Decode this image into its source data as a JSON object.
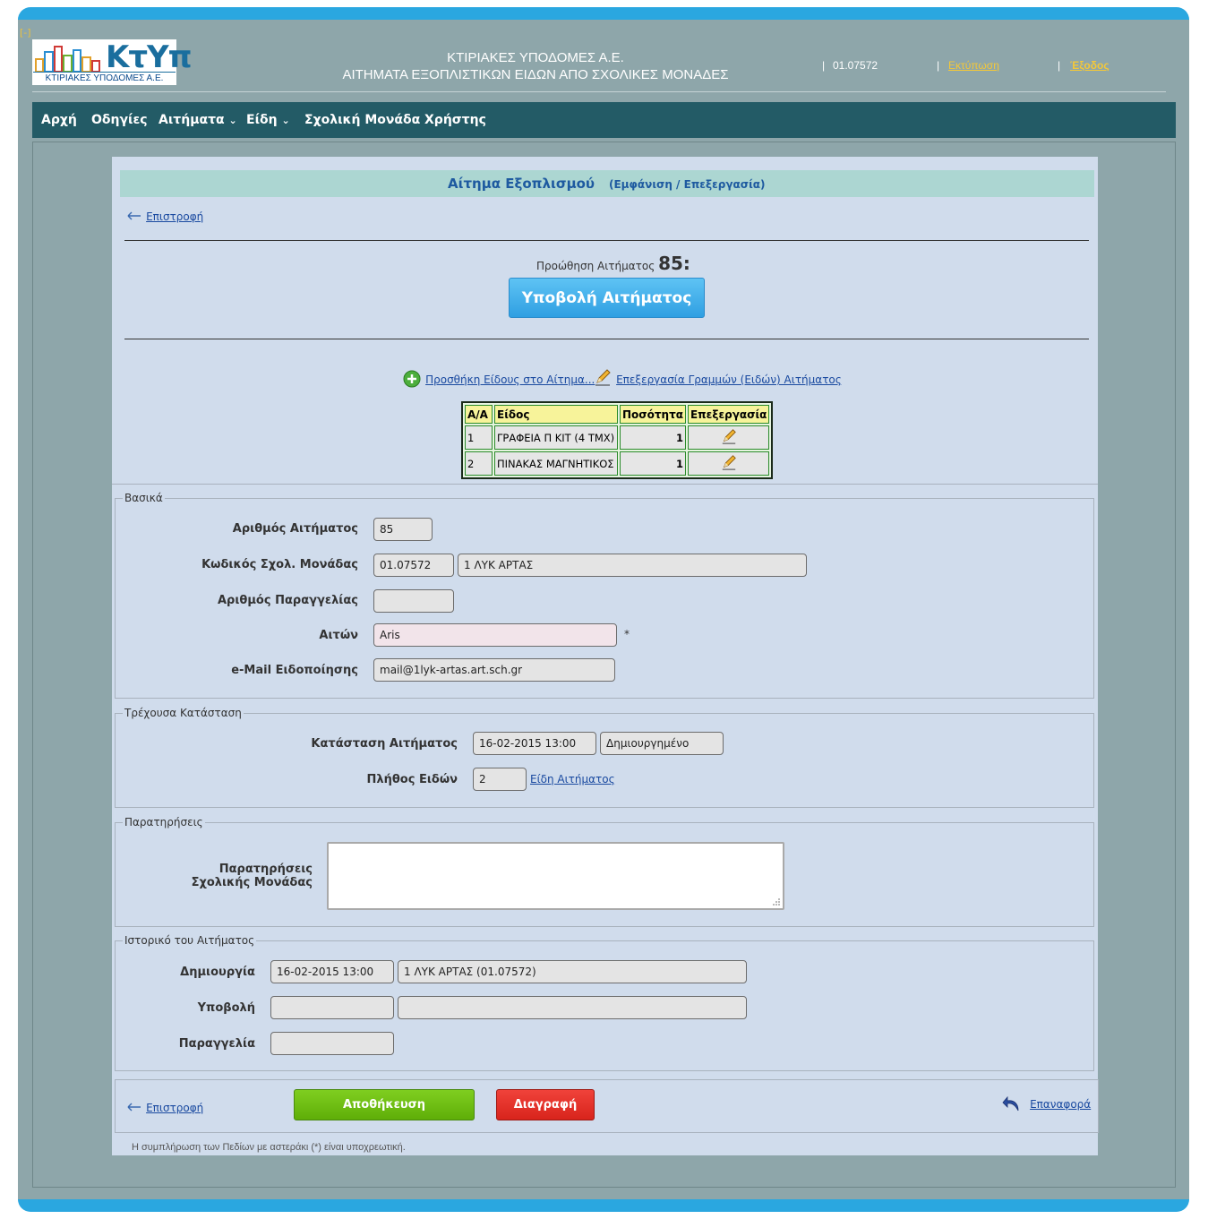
{
  "header": {
    "toggle": "[-]",
    "logo_text": "ΚτΥπ",
    "logo_sub": "ΚΤΙΡΙΑΚΕΣ ΥΠΟΔΟΜΕΣ Α.Ε.",
    "title_line1": "ΚΤΙΡΙΑΚΕΣ ΥΠΟΔΟΜΕΣ Α.Ε.",
    "title_line2": "ΑΙΤΗΜΑΤΑ ΕΞΟΠΛΙΣΤΙΚΩΝ ΕΙΔΩΝ ΑΠΟ ΣΧΟΛΙΚΕΣ ΜΟΝΑΔΕΣ",
    "user_code": "01.07572",
    "print_label": "Εκτύπωση",
    "exit_label": "Έξοδος",
    "separator": "|"
  },
  "nav": {
    "home": "Αρχή",
    "guide": "Οδηγίες",
    "requests": "Αιτήματα",
    "items": "Είδη",
    "school": "Σχολική Μονάδα",
    "user": "Χρήστης",
    "dropdown_glyph": "⌄"
  },
  "page": {
    "title": "Αίτημα Εξοπλισμού",
    "mode": "(Εμφάνιση / Επεξεργασία)",
    "back_label": "Επιστροφή",
    "promote_label": "Προώθηση Αιτήματος",
    "promote_number": "85:",
    "submit_label": "Υποβολή Αιτήματος",
    "add_item_label": " Προσθήκη Είδους στο Αίτημα...",
    "edit_lines_label": " Επεξεργασία Γραμμών (Ειδών) Αιτήματος"
  },
  "items_table": {
    "headers": [
      "Α/Α",
      "Είδος",
      "Ποσότητα",
      "Επεξεργασία"
    ],
    "rows": [
      {
        "aa": "1",
        "item": "ΓΡΑΦΕΙΑ Π ΚΙΤ (4 ΤΜΧ)",
        "qty": "1"
      },
      {
        "aa": "2",
        "item": "ΠΙΝΑΚΑΣ ΜΑΓΝΗΤΙΚΟΣ",
        "qty": "1"
      }
    ]
  },
  "basic": {
    "legend": "Βασικά",
    "request_no_label": "Αριθμός Αιτήματος",
    "request_no": "85",
    "school_code_label": "Κωδικός Σχολ. Μονάδας",
    "school_code": "01.07572",
    "school_name": "1  ΛΥΚ  ΑΡΤΑΣ",
    "order_no_label": "Αριθμός Παραγγελίας",
    "order_no": "",
    "requester_label": "Αιτών",
    "requester": "Aris",
    "required_mark": "*",
    "email_label": "e-Mail Ειδοποίησης",
    "email": "mail@1lyk-artas.art.sch.gr"
  },
  "status": {
    "legend": "Τρέχουσα Κατάσταση",
    "state_label": "Κατάσταση Αιτήματος",
    "state_date": "16-02-2015 13:00",
    "state_value": "Δημιουργημένο",
    "count_label": "Πλήθος Ειδών",
    "count_value": "2",
    "items_link": "Είδη Αιτήματος"
  },
  "remarks": {
    "legend": "Παρατηρήσεις",
    "label_line1": "Παρατηρήσεις",
    "label_line2": "Σχολικής Μονάδας",
    "value": ""
  },
  "history": {
    "legend": "Ιστορικό του Αιτήματος",
    "created_label": "Δημιουργία",
    "created_date": "16-02-2015 13:00",
    "created_by": "1  ΛΥΚ  ΑΡΤΑΣ (01.07572)",
    "submitted_label": "Υποβολή",
    "submitted_date": "",
    "submitted_by": "",
    "ordered_label": "Παραγγελία",
    "ordered_date": ""
  },
  "footer": {
    "back_label": "Επιστροφή",
    "save_label": "Αποθήκευση",
    "delete_label": "Διαγραφή",
    "reset_label": "Επαναφορά",
    "note": "Η συμπλήρωση των Πεδίων με αστεράκι (*) είναι υποχρεωτική."
  },
  "colors": {
    "accent": "#2aa7e0",
    "nav_bg": "#235b66",
    "panel_bg": "#d0dcec",
    "save_green": "#6fbe14",
    "delete_red": "#e0302a"
  }
}
